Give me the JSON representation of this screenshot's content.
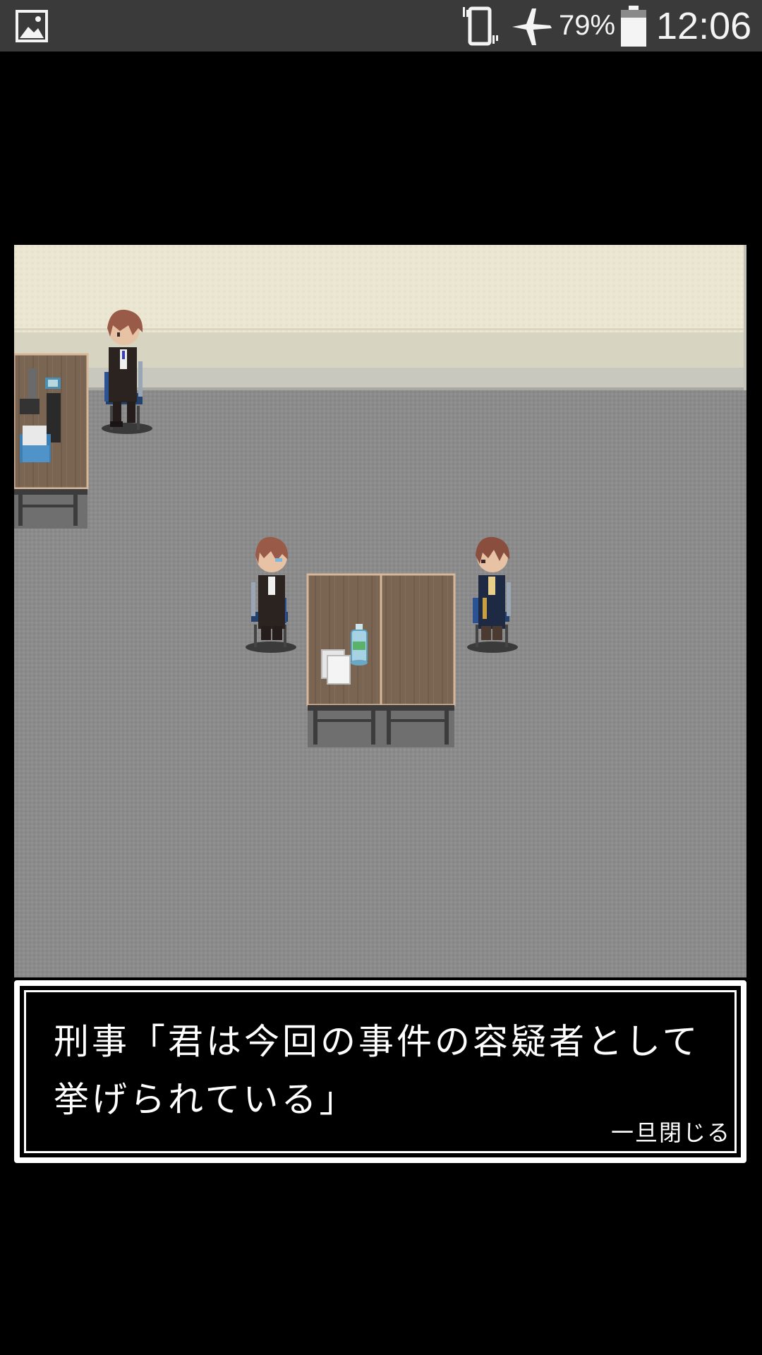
{
  "status_bar": {
    "battery_percent": "79%",
    "time": "12:06",
    "icons": [
      "gallery-icon",
      "vibrate-icon",
      "airplane-mode-icon",
      "battery-icon"
    ]
  },
  "scene": {
    "location": "interrogation room",
    "characters": [
      "detective-standing",
      "suspect-seated",
      "detective-seated"
    ]
  },
  "dialog": {
    "message": "刑事「君は今回の事件の容疑者として挙げられている」",
    "close_label": "一旦閉じる"
  },
  "colors": {
    "status_bar": "#3a3a3a",
    "wall": "#ebe7d5",
    "floor": "#8d8d8d",
    "desk": "#7b6652",
    "dialog_border": "#ffffff"
  }
}
